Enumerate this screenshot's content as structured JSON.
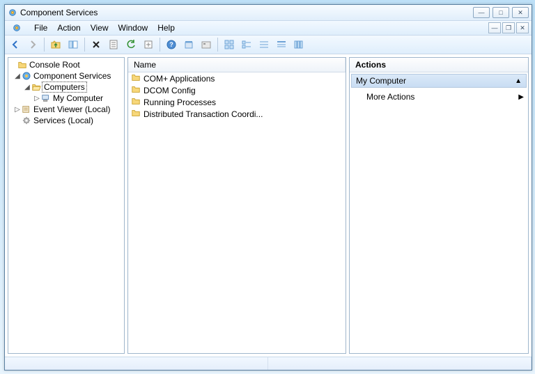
{
  "window_title": "Component Services",
  "menu": {
    "file": "File",
    "action": "Action",
    "view": "View",
    "window": "Window",
    "help": "Help"
  },
  "tree": {
    "root": "Console Root",
    "comp_services": "Component Services",
    "computers": "Computers",
    "my_computer": "My Computer",
    "event_viewer": "Event Viewer (Local)",
    "services": "Services (Local)"
  },
  "list": {
    "header_name": "Name",
    "items": [
      "COM+ Applications",
      "DCOM Config",
      "Running Processes",
      "Distributed Transaction Coordi..."
    ]
  },
  "actions": {
    "header": "Actions",
    "section": "My Computer",
    "more": "More Actions"
  }
}
